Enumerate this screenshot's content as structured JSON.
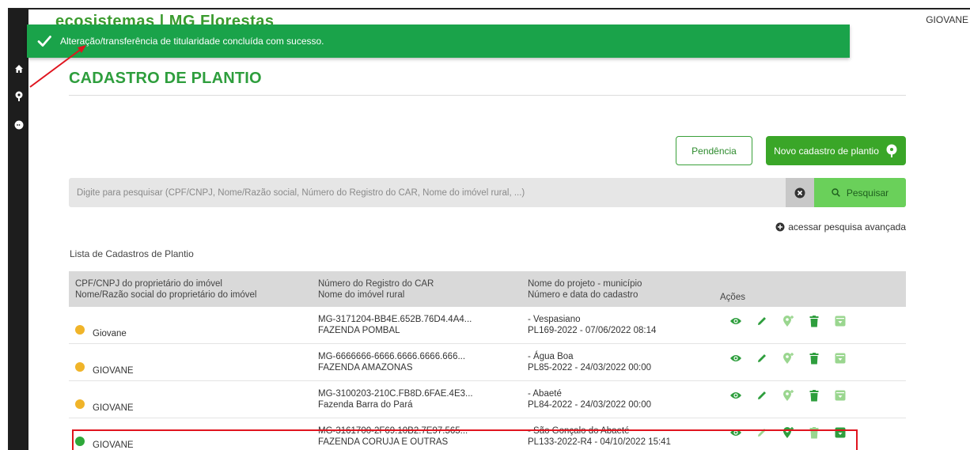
{
  "header": {
    "brand": "ecosistemas | MG Florestas",
    "user": "GIOVANE"
  },
  "toast": {
    "message": "Alteração/transferência de titularidade concluída com sucesso.",
    "color": "#1aa34a"
  },
  "sidebar": {
    "items": [
      {
        "icon": "home-icon"
      },
      {
        "icon": "tree-icon"
      },
      {
        "icon": "chat-icon"
      }
    ]
  },
  "page": {
    "title": "CADASTRO DE PLANTIO",
    "accent": "#2e9e3d"
  },
  "buttons": {
    "pendencia": "Pendência",
    "novo": "Novo cadastro de plantio"
  },
  "search": {
    "placeholder": "Digite para pesquisar (CPF/CNPJ, Nome/Razão social, Número do Registro do CAR, Nome do imóvel rural, ...)",
    "button": "Pesquisar",
    "advanced": "acessar pesquisa avançada"
  },
  "list": {
    "title": "Lista de Cadastros de Plantio",
    "columns": [
      {
        "line1": "CPF/CNPJ do proprietário do imóvel",
        "line2": "Nome/Razão social do proprietário do imóvel"
      },
      {
        "line1": "Número do Registro do CAR",
        "line2": "Nome do imóvel rural"
      },
      {
        "line1": "Nome do projeto - município",
        "line2": "Número e data do cadastro"
      },
      {
        "line1": "Ações",
        "line2": ""
      }
    ],
    "rows": [
      {
        "status": "pending",
        "owner": "Giovane",
        "car": "MG-3171204-BB4E.652B.76D4.4A4...",
        "property": "FAZENDA POMBAL",
        "municipality": "- Vespasiano",
        "record": "PL169-2022 - 07/06/2022 08:14"
      },
      {
        "status": "pending",
        "owner": "GIOVANE",
        "car": "MG-6666666-6666.6666.6666.666...",
        "property": "FAZENDA AMAZONAS",
        "municipality": "- Água Boa",
        "record": "PL85-2022 - 24/03/2022 00:00"
      },
      {
        "status": "pending",
        "owner": "GIOVANE",
        "car": "MG-3100203-210C.FB8D.6FAE.4E3...",
        "property": "Fazenda Barra do Pará",
        "municipality": "- Abaeté",
        "record": "PL84-2022 - 24/03/2022 00:00"
      },
      {
        "status": "ok",
        "owner": "GIOVANE",
        "car": "MG-3161700-2F69.10B2.7E97.565...",
        "property": "FAZENDA CORUJA E OUTRAS",
        "municipality": "- São Gonçalo do Abaeté",
        "record": "PL133-2022-R4 - 04/10/2022 15:41"
      }
    ]
  }
}
